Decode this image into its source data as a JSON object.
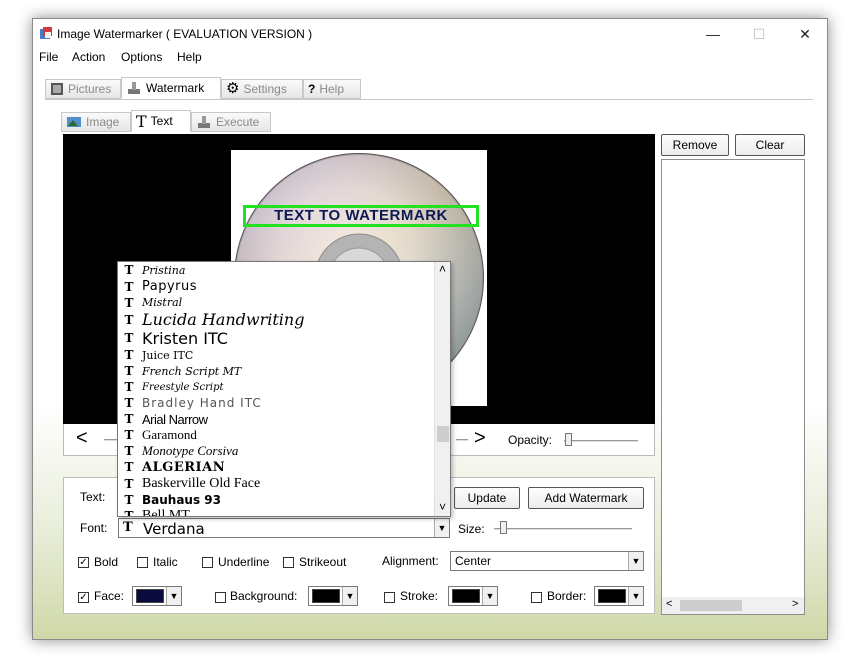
{
  "window": {
    "title": "Image Watermarker ( EVALUATION VERSION )",
    "controls": {
      "minimize": "—",
      "maximize": "☐",
      "close": "✕"
    }
  },
  "menu": [
    "File",
    "Action",
    "Options",
    "Help"
  ],
  "main_tabs": [
    {
      "label": "Pictures",
      "icon": "pictures-icon",
      "active": false
    },
    {
      "label": "Watermark",
      "icon": "watermark-icon",
      "active": true
    },
    {
      "label": "Settings",
      "icon": "gear-icon",
      "active": false
    },
    {
      "label": "Help",
      "icon": "help-icon",
      "active": false
    }
  ],
  "sub_tabs": [
    {
      "label": "Image",
      "icon": "image-icon",
      "active": false
    },
    {
      "label": "Text",
      "icon": "text-icon",
      "active": true
    },
    {
      "label": "Execute",
      "icon": "execute-icon",
      "active": false
    }
  ],
  "preview": {
    "watermark_text": "TEXT TO WATERMARK",
    "watermark_color": "#0b1a55",
    "border_color": "#22e022"
  },
  "nav": {
    "prev": "<",
    "next": ">",
    "opacity_label": "Opacity:"
  },
  "right_panel": {
    "remove_label": "Remove",
    "clear_label": "Clear"
  },
  "form": {
    "text_label": "Text:",
    "font_label": "Font:",
    "font_value": "Verdana",
    "update_label": "Update",
    "add_watermark_label": "Add Watermark",
    "size_label": "Size:",
    "alignment_label": "Alignment:",
    "alignment_value": "Center",
    "checks": {
      "bold": {
        "label": "Bold",
        "checked": true
      },
      "italic": {
        "label": "Italic",
        "checked": false
      },
      "underline": {
        "label": "Underline",
        "checked": false
      },
      "strikeout": {
        "label": "Strikeout",
        "checked": false
      },
      "face": {
        "label": "Face:",
        "checked": true,
        "color": "#0a0a3c"
      },
      "background": {
        "label": "Background:",
        "checked": false,
        "color": "#000000"
      },
      "stroke": {
        "label": "Stroke:",
        "checked": false,
        "color": "#000000"
      },
      "border": {
        "label": "Border:",
        "checked": false,
        "color": "#000000"
      }
    }
  },
  "font_list": [
    "Pristina",
    "Papyrus",
    "Mistral",
    "Lucida Handwriting",
    "Kristen ITC",
    "Juice ITC",
    "French Script MT",
    "Freestyle Script",
    "Bradley Hand ITC",
    "Arial Narrow",
    "Garamond",
    "Monotype Corsiva",
    "ALGERIAN",
    "Baskerville Old Face",
    "Bauhaus 93",
    "Bell MT"
  ],
  "font_icon_glyph": "T",
  "scroll_glyphs": {
    "up": "˄",
    "down": "˅",
    "left": "<",
    "right": ">"
  }
}
